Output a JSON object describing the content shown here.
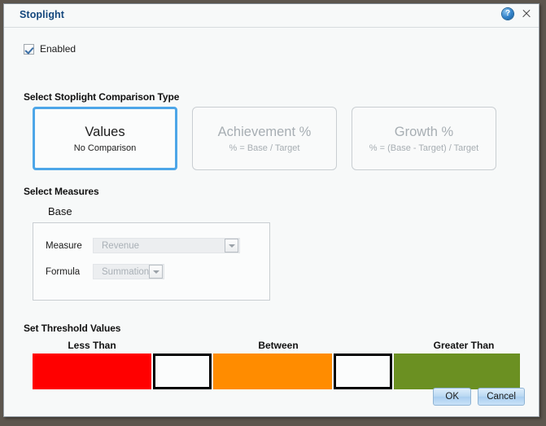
{
  "window": {
    "title": "Stoplight",
    "help_icon": "help-circle-icon",
    "close_icon": "close-icon"
  },
  "enabled": {
    "label": "Enabled",
    "checked": true
  },
  "comparison": {
    "heading": "Select Stoplight Comparison Type",
    "selected_index": 0,
    "cards": [
      {
        "title": "Values",
        "subtitle": "No Comparison",
        "selected": true
      },
      {
        "title": "Achievement %",
        "subtitle": "% = Base / Target",
        "selected": false
      },
      {
        "title": "Growth %",
        "subtitle": "% = (Base - Target) / Target",
        "selected": false
      }
    ]
  },
  "measures": {
    "heading": "Select Measures",
    "group_label": "Base",
    "fields": [
      {
        "label": "Measure",
        "value": "Revenue"
      },
      {
        "label": "Formula",
        "value": "Summation"
      }
    ]
  },
  "threshold": {
    "heading": "Set Threshold Values",
    "labels": [
      {
        "text": "Less Than"
      },
      {
        "text": "Between"
      },
      {
        "text": "Greater Than"
      }
    ],
    "swatches": [
      {
        "name": "less-than-color",
        "color": "#ff0000"
      },
      {
        "name": "between-color",
        "color": "#ff8c00"
      },
      {
        "name": "greater-than-color",
        "color": "#6b9022"
      }
    ],
    "inputs": [
      {
        "name": "threshold-lower-input",
        "value": "",
        "placeholder": ""
      },
      {
        "name": "threshold-upper-input",
        "value": "",
        "placeholder": ""
      }
    ]
  },
  "footer": {
    "ok_label": "OK",
    "cancel_label": "Cancel"
  },
  "colors": {
    "title": "#14477d",
    "selected_border": "#4da6e8",
    "red": "#ff0000",
    "orange": "#ff8c00",
    "green": "#6b9022"
  }
}
